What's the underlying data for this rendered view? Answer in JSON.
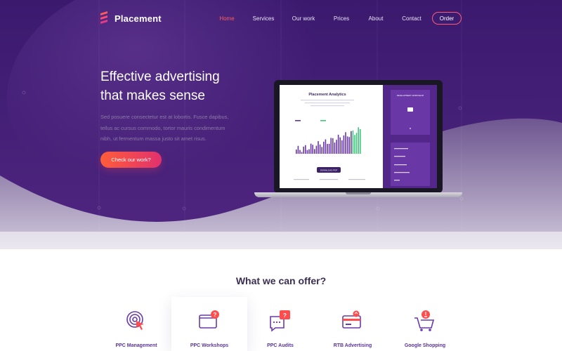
{
  "brand": {
    "name": "Placement"
  },
  "nav": {
    "items": [
      "Home",
      "Services",
      "Our work",
      "Prices",
      "About",
      "Contact"
    ],
    "active": "Home",
    "order_label": "Order"
  },
  "hero": {
    "headline_line1": "Effective advertising",
    "headline_line2": "that makes sense",
    "subtext": "Sed posuere consectetur est at lobortis. Fusce dapibus, tellus ac cursus commodo, tortor mauris condimentum nibh, ut fermentum massa justo sit amet risus.",
    "cta_label": "Check our work?"
  },
  "laptop": {
    "screen_title": "Placement Analytics",
    "download_label": "DOWNLOAD PDF",
    "panel_title": "DEVELOPMENT WORKSHOP"
  },
  "offer": {
    "title": "What we can offer?",
    "services": [
      {
        "label": "PPC Management",
        "icon": "target-cursor-icon"
      },
      {
        "label": "PPC Workshops",
        "icon": "browser-question-icon"
      },
      {
        "label": "PPC Audits",
        "icon": "chat-question-icon"
      },
      {
        "label": "RTB Advertising",
        "icon": "card-ad-icon"
      },
      {
        "label": "Google Shopping",
        "icon": "cart-bulb-icon"
      }
    ]
  },
  "colors": {
    "hero_bg_dark": "#3a1a6a",
    "hero_bg_mid": "#5a2a8e",
    "accent_red": "#ff4d4d",
    "accent_purple": "#5a3596",
    "section_text": "#3a2f52"
  }
}
